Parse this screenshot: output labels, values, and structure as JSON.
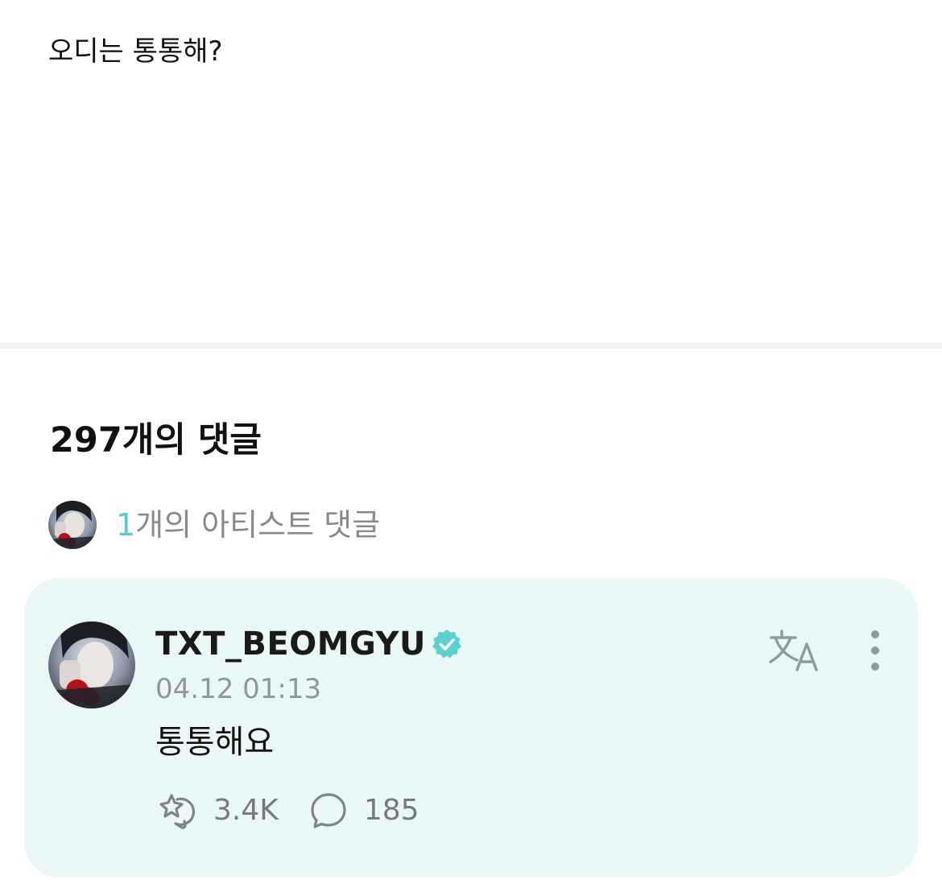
{
  "post": {
    "body_text": "오디는 통통해?"
  },
  "comments_section": {
    "header_count_label": "297개의 댓글",
    "artist_comments": {
      "count": "1",
      "label_suffix": "개의 아티스트 댓글"
    }
  },
  "artist_comment": {
    "username": "TXT_BEOMGYU",
    "verified": true,
    "timestamp": "04.12 01:13",
    "text": "통통해요",
    "likes": "3.4K",
    "replies": "185"
  },
  "icons": {
    "verified": "verified-badge-icon",
    "translate": "translate-icon",
    "more": "more-vertical-icon",
    "like": "sparkle-like-icon",
    "reply": "speech-bubble-icon"
  },
  "colors": {
    "accent": "#5cc8c8",
    "card_background": "#e9f8f6",
    "muted_text": "#8f9898",
    "verified_badge": "#5ccfd0"
  }
}
